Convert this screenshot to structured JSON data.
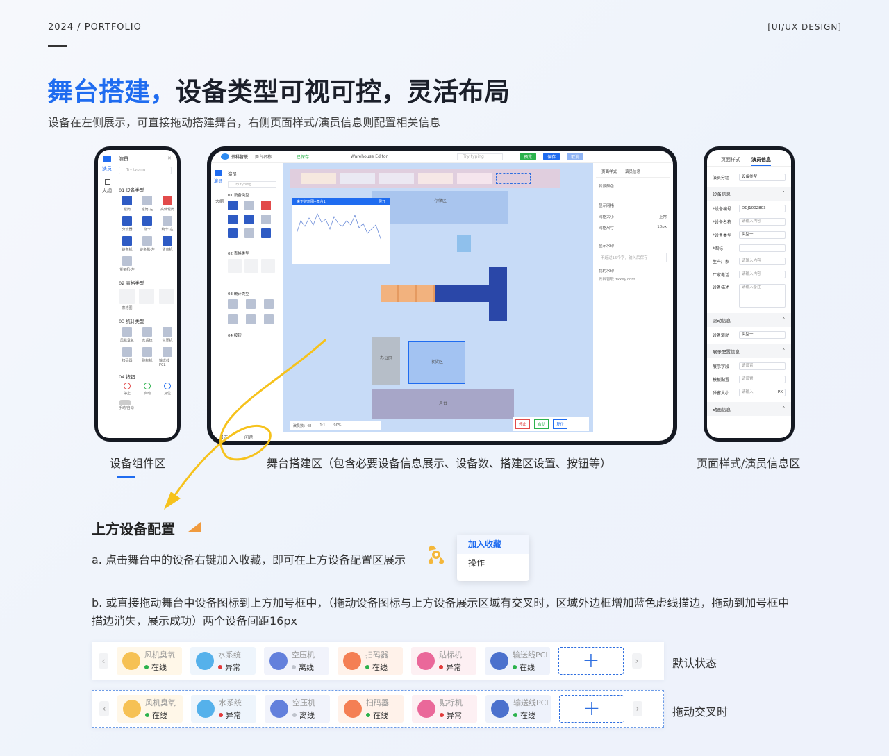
{
  "header": {
    "left": "2024 / PORTFOLIO",
    "right": "[UI/UX DESIGN]"
  },
  "title": {
    "highlight": "舞台搭建，",
    "rest": "设备类型可视可控，灵活布局"
  },
  "subtitle": "设备在左侧展示，可直接拖动搭建舞台，右侧页面样式/演员信息则配置相关信息",
  "captions": {
    "left": "设备组件区",
    "middle": "舞台搭建区（包含必要设备信息展示、设备数、搭建区设置、按钮等）",
    "right": "页面样式/演员信息区"
  },
  "left_panel": {
    "tab_actor": "演员",
    "tab_outline": "大纲",
    "panel_title": "演员",
    "search_placeholder": "Try typing",
    "sec1": "01 设备类型",
    "sec2": "02 表格类型",
    "sec3": "03 统计类型",
    "sec4": "04 按钮",
    "dev_items": [
      "辊筒",
      "辊筒-左",
      "高体辊筒",
      "分流器",
      "绕卡",
      "绕卡-左",
      "链条机",
      "链条机-左",
      "货盘机",
      "货架机-左"
    ],
    "table_items": [
      "表格图"
    ],
    "stat_items": [
      "风机臭氧",
      "水系统",
      "空压机",
      "扫码器",
      "贴标机",
      "输送线PCL"
    ],
    "btn_items": [
      "停止",
      "启动",
      "复位"
    ],
    "toggle": "手动/自动"
  },
  "middle": {
    "brand": "云科智联",
    "stage_name": "舞台名称",
    "saved": "已保存",
    "editor": "Warehouse Editor",
    "search": "Try typing",
    "btn_preview": "预览",
    "btn_save": "保存",
    "btn_cancel": "取消",
    "chart_title": "来下波形图--舞台1",
    "chart_expand": "展开",
    "zones": {
      "storage": "存储区",
      "office": "办公区",
      "receive": "收货区",
      "platform": "月台"
    },
    "footer": {
      "count_label": "演员数：48",
      "ratio": "1:1",
      "zoom": "90%"
    },
    "bottom_btns": [
      "停止",
      "启动",
      "复位"
    ],
    "right": {
      "tab1": "页面样式",
      "tab2": "演员信息",
      "bg": "背景颜色",
      "show_grid": "显示网格",
      "grid_size": "网格大小",
      "grid_size_val": "正常",
      "grid_dim": "网格尺寸",
      "grid_dim_val": "10px",
      "watermark": "显示水印",
      "wm_ph": "不超过15个字，输入后保存",
      "my_wm": "我的水印",
      "wm_val": "云科智联 Ykkey.com"
    },
    "bottom_tabs": [
      "日志",
      "问题"
    ]
  },
  "right_panel": {
    "tab1": "页面样式",
    "tab2": "演员信息",
    "group_label": "演员分组",
    "group_val": "设备类型",
    "sec_dev": "设备信息",
    "dev_no": "*设备编号",
    "dev_no_val": "DDJ1002803",
    "dev_name": "*设备名称",
    "dev_name_ph": "请输入内容",
    "dev_type": "*设备类型",
    "dev_type_val": "类型一",
    "icon": "*图标",
    "maker": "生产厂家",
    "maker_ph": "请输入内容",
    "tel": "厂家电话",
    "tel_ph": "请输入内容",
    "desc": "设备描述",
    "desc_ph": "请输入备注",
    "sec_drive": "驱动信息",
    "drive": "设备驱动",
    "drive_val": "类型一",
    "sec_show": "展示配置信息",
    "field": "展示字段",
    "field_ph": "请设置",
    "tpl": "模板配置",
    "tpl_ph": "请设置",
    "pop": "弹窗大小",
    "pop_ph": "请输入",
    "pop_unit": "PX",
    "sec_anim": "动画信息"
  },
  "section": {
    "title": "上方设备配置",
    "a": "a. 点击舞台中的设备右键加入收藏，即可在上方设备配置区展示",
    "b": "b. 或直接拖动舞台中设备图标到上方加号框中，（拖动设备图标与上方设备展示区域有交叉时，区域外边框增加蓝色虚线描边，拖动到加号框中描边消失，展示成功）两个设备间距16px",
    "menu": [
      "加入收藏",
      "操作"
    ],
    "state_default": "默认状态",
    "state_drag": "拖动交叉时"
  },
  "devices": [
    {
      "name": "风机臭氧",
      "status": "在线",
      "bg": "#fff7e8",
      "icon": "#f4b73a",
      "dot": "#2bb24c"
    },
    {
      "name": "水系统",
      "status": "异常",
      "bg": "#eef5fc",
      "icon": "#3aa4e8",
      "dot": "#e23b3b"
    },
    {
      "name": "空压机",
      "status": "离线",
      "bg": "#f1f3fb",
      "icon": "#4a6bd6",
      "dot": "#bfc3cc"
    },
    {
      "name": "扫码器",
      "status": "在线",
      "bg": "#fff2ea",
      "icon": "#f26b3a",
      "dot": "#2bb24c"
    },
    {
      "name": "贴标机",
      "status": "异常",
      "bg": "#fdf0f3",
      "icon": "#e6508a",
      "dot": "#e23b3b"
    },
    {
      "name": "输送线PCL",
      "status": "在线",
      "bg": "#eef2fb",
      "icon": "#2e5bc4",
      "dot": "#2bb24c"
    }
  ]
}
